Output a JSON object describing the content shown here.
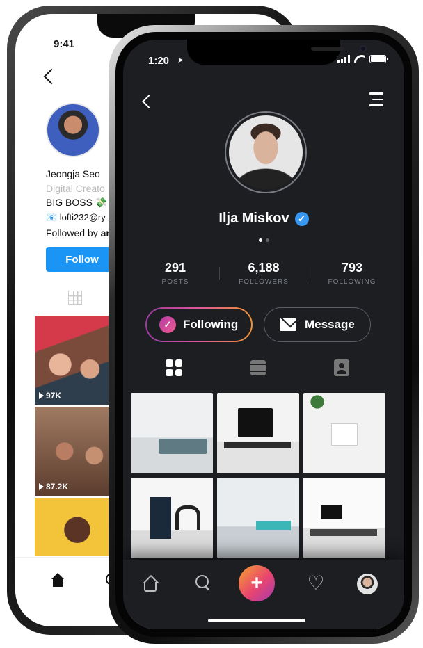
{
  "back_phone": {
    "status_time": "9:41",
    "profile": {
      "name": "Jeongja Seo",
      "category": "Digital Creato",
      "bio_line1": "BIG BOSS 💸",
      "bio_line2": "📧 lofti232@ry.",
      "followed_by_prefix": "Followed by ",
      "followed_by_name": "ar"
    },
    "follow_label": "Follow",
    "posts": [
      {
        "views": "97K"
      },
      {
        "views": "87.2K"
      }
    ]
  },
  "front_phone": {
    "status_time": "1:20",
    "location_icon": "➤",
    "profile_name": "Ilja Miskov",
    "verified_icon": "✓",
    "stats": [
      {
        "value": "291",
        "label": "POSTS"
      },
      {
        "value": "6,188",
        "label": "FOLLOWERS"
      },
      {
        "value": "793",
        "label": "FOLLOWING"
      }
    ],
    "following_label": "Following",
    "message_label": "Message",
    "check_icon": "✓",
    "nav_add_icon": "+",
    "nav_heart_icon": "♡",
    "colors": {
      "background": "#1d1e22",
      "gradient_start": "#9b3aa1",
      "gradient_mid": "#e0559b",
      "gradient_end": "#f09433",
      "verified": "#3897f0",
      "follow_blue": "#1b95f5"
    }
  }
}
